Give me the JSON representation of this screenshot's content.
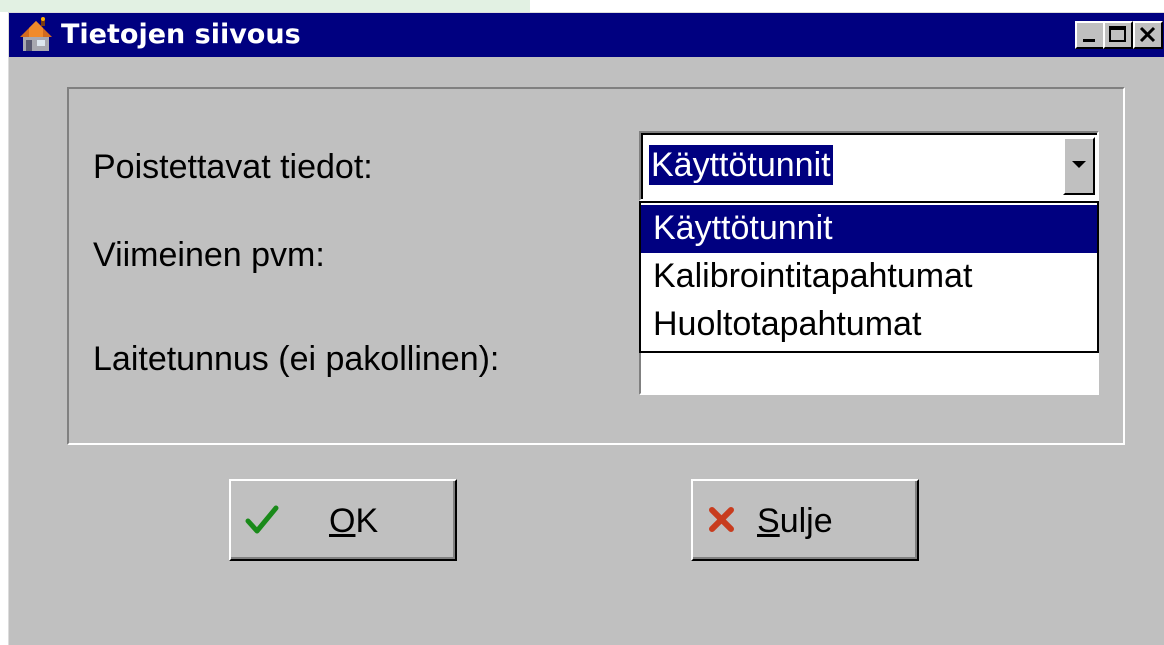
{
  "window": {
    "title": "Tietojen siivous"
  },
  "form": {
    "label_data": "Poistettavat tiedot:",
    "label_date": "Viimeinen pvm:",
    "label_device": "Laitetunnus (ei pakollinen):",
    "combo_value": "Käyttötunnit",
    "dropdown_options": [
      "Käyttötunnit",
      "Kalibrointitapahtumat",
      "Huoltotapahtumat"
    ],
    "date_value": "",
    "device_value": ""
  },
  "buttons": {
    "ok": {
      "mnemonic": "O",
      "rest": "K",
      "icon": "checkmark-icon"
    },
    "close": {
      "mnemonic": "S",
      "rest": "ulje",
      "icon": "x-icon"
    }
  },
  "colors": {
    "titlebar": "#000080",
    "face": "#c0c0c0",
    "selection": "#000080",
    "ok_check": "#1a8a1a",
    "close_x": "#c83c1e"
  }
}
